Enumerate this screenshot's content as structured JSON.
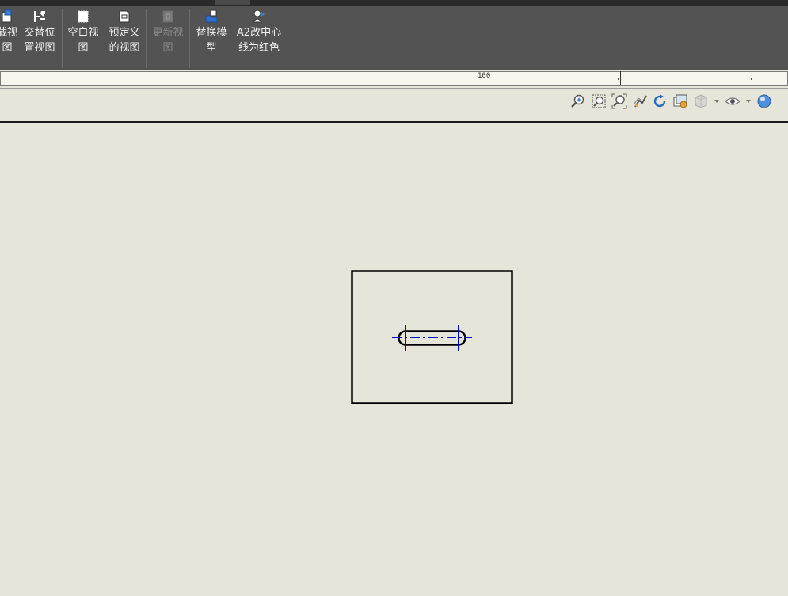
{
  "ribbon": {
    "buttons": [
      {
        "line1": "载视",
        "line2": "图",
        "icon": "load-view-icon"
      },
      {
        "line1": "交替位",
        "line2": "置视图",
        "icon": "alternate-position-view-icon"
      },
      {
        "line1": "空白视",
        "line2": "图",
        "icon": "blank-view-icon"
      },
      {
        "line1": "预定义",
        "line2": "的视图",
        "icon": "predefined-view-icon"
      },
      {
        "line1": "更新视",
        "line2": "图",
        "icon": "update-view-icon"
      },
      {
        "line1": "替换模",
        "line2": "型",
        "icon": "replace-model-icon"
      },
      {
        "line1": "A2改中心",
        "line2": "线为红色",
        "icon": "centerline-red-icon"
      }
    ]
  },
  "ruler": {
    "label": "100"
  },
  "view_toolbar": {
    "icons": [
      "zoom-in-icon",
      "zoom-window-icon",
      "zoom-out-icon",
      "pan-icon",
      "redraw-icon",
      "display-style-icon",
      "view-manager-icon",
      "visibility-icon",
      "globe-icon"
    ]
  },
  "drawing": {
    "outline_color": "#000000",
    "centerline_color": "#0000cc"
  }
}
